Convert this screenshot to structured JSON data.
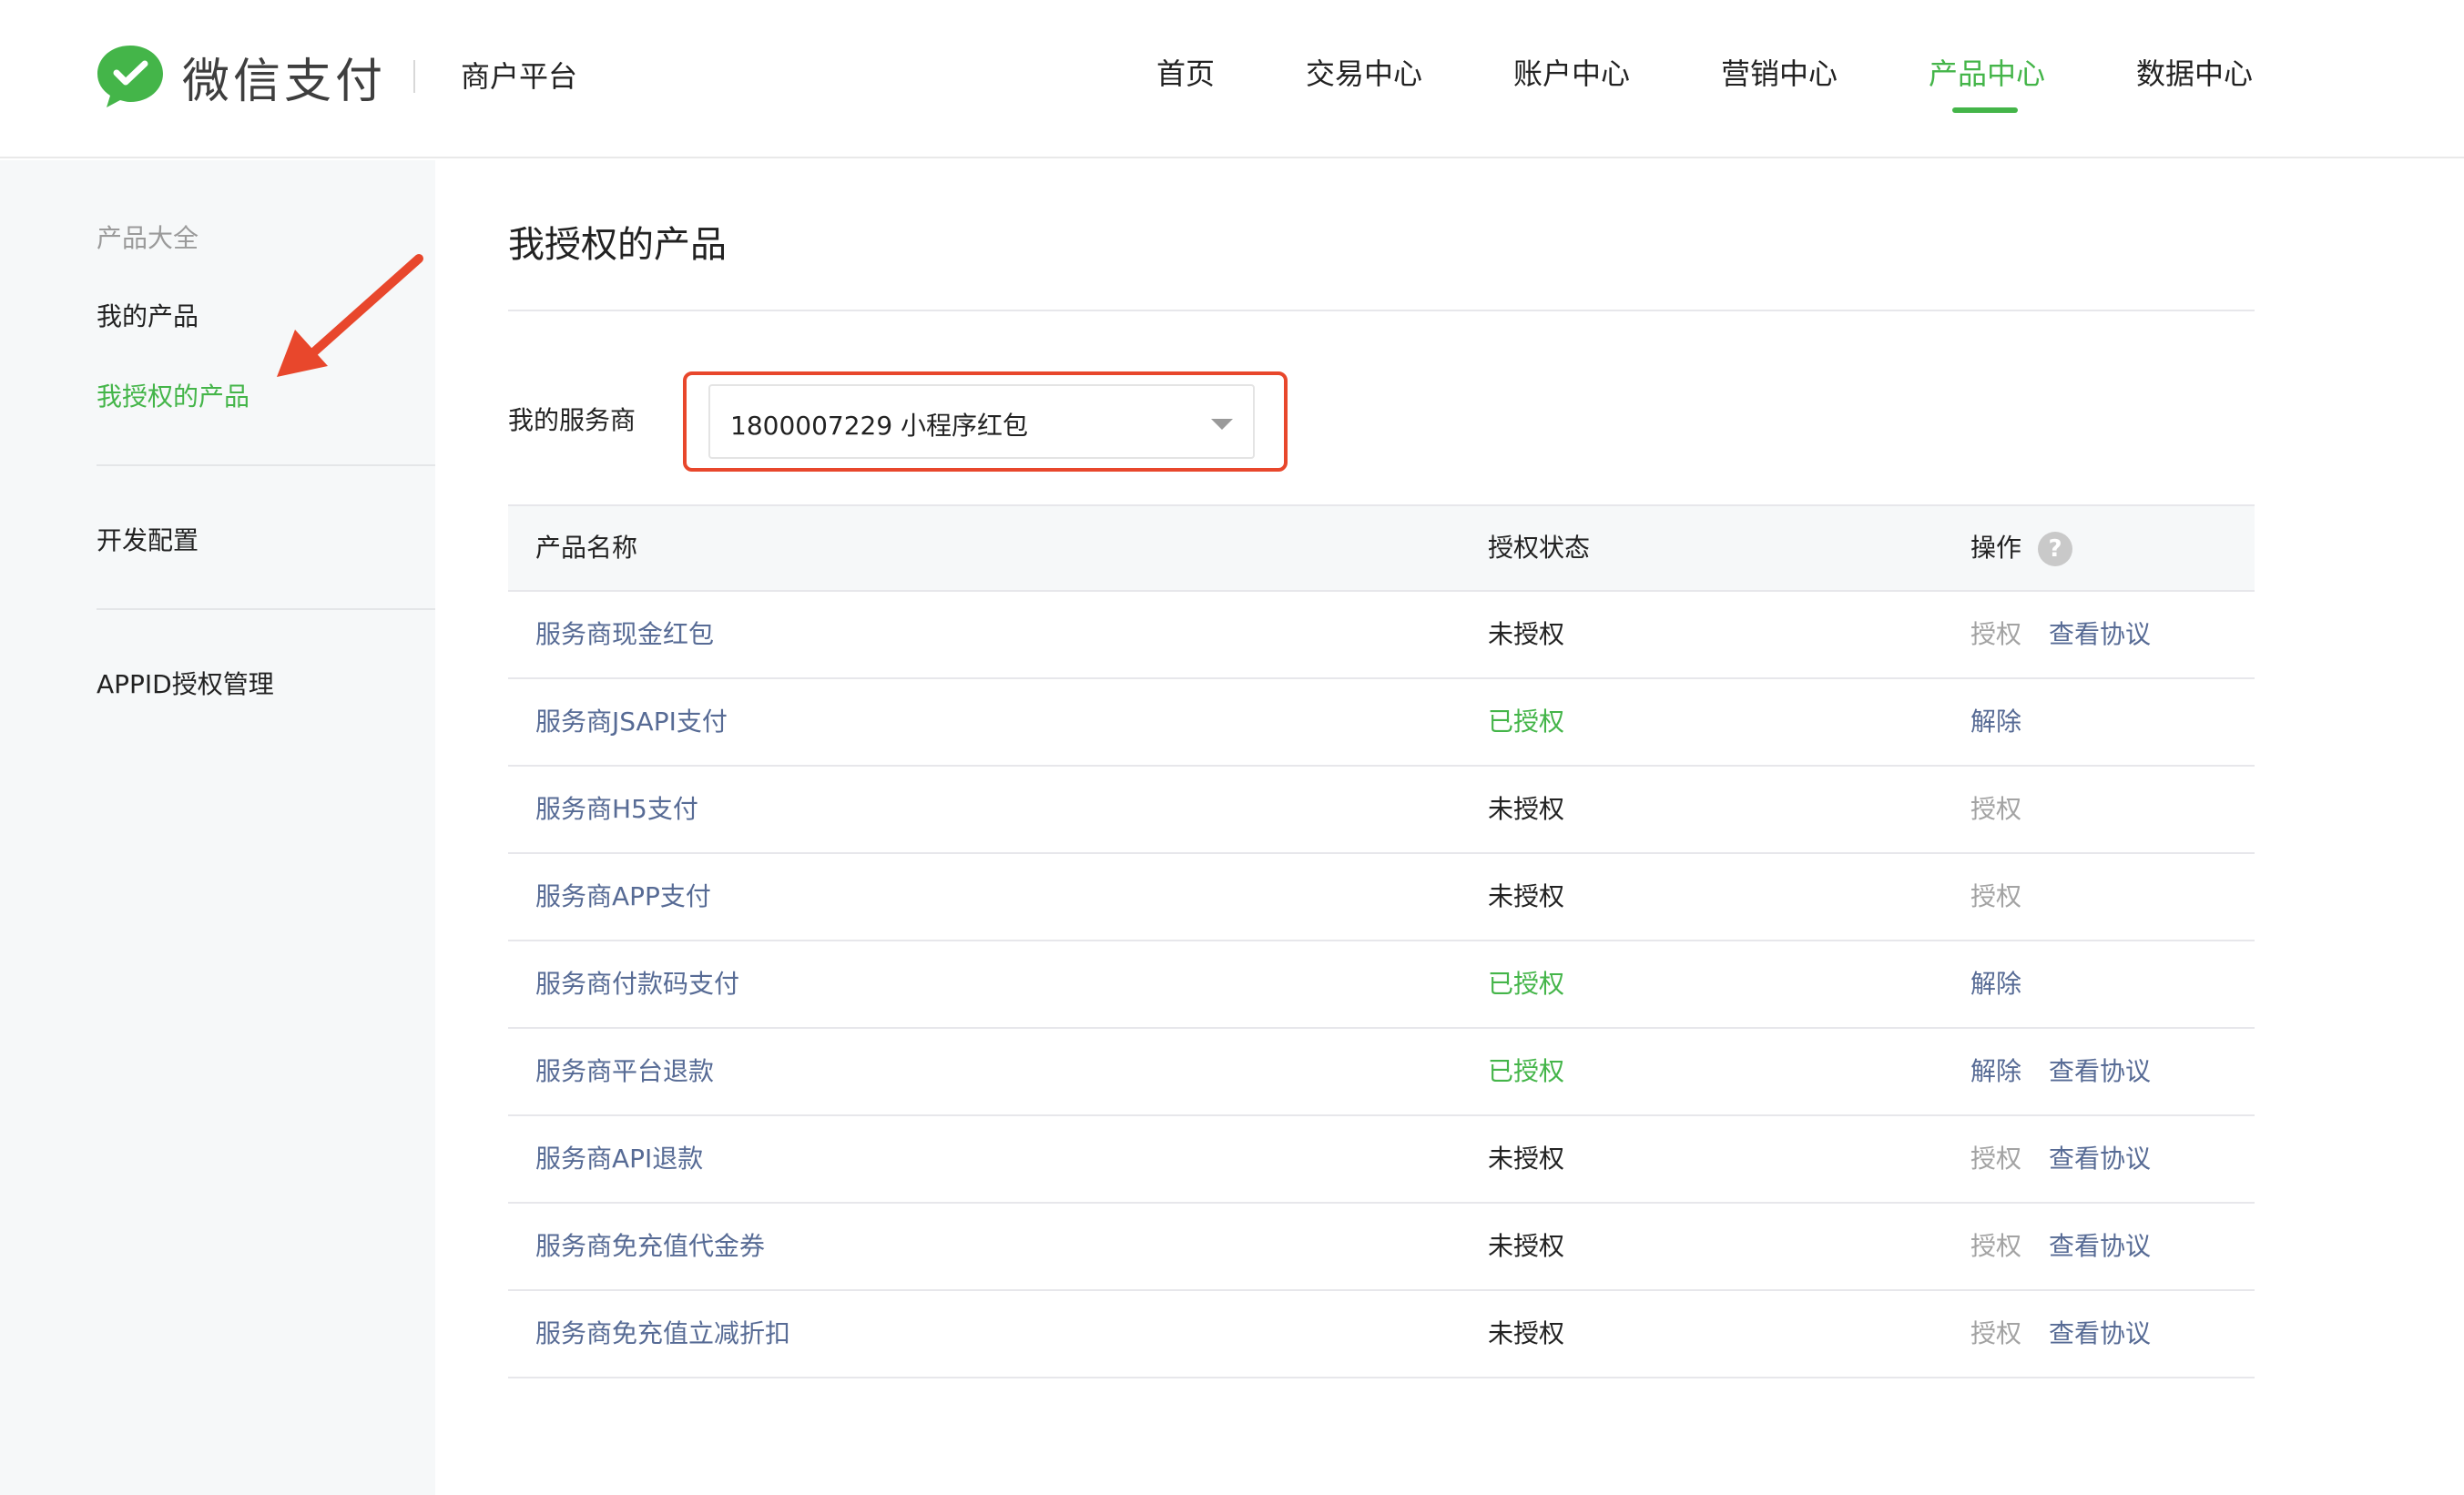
{
  "brand": {
    "name": "微信支付",
    "platform": "商户平台",
    "brand_color": "#44b549"
  },
  "nav": {
    "items": [
      "首页",
      "交易中心",
      "账户中心",
      "营销中心",
      "产品中心",
      "数据中心"
    ],
    "active": "产品中心"
  },
  "sidebar": {
    "group_title": "产品大全",
    "items": [
      "我的产品",
      "我授权的产品"
    ],
    "active": "我授权的产品",
    "dev_config": "开发配置",
    "appid": "APPID授权管理"
  },
  "main": {
    "title": "我授权的产品",
    "filter_label": "我的服务商",
    "selected_provider": "1800007229 小程序红包"
  },
  "table": {
    "headers": {
      "name": "产品名称",
      "status": "授权状态",
      "action": "操作",
      "help": "?"
    },
    "rows": [
      {
        "name": "服务商现金红包",
        "status": "未授权",
        "authorized": false,
        "action": "授权",
        "agreement": "查看协议"
      },
      {
        "name": "服务商JSAPI支付",
        "status": "已授权",
        "authorized": true,
        "action": "解除",
        "agreement": ""
      },
      {
        "name": "服务商H5支付",
        "status": "未授权",
        "authorized": false,
        "action": "授权",
        "agreement": ""
      },
      {
        "name": "服务商APP支付",
        "status": "未授权",
        "authorized": false,
        "action": "授权",
        "agreement": ""
      },
      {
        "name": "服务商付款码支付",
        "status": "已授权",
        "authorized": true,
        "action": "解除",
        "agreement": ""
      },
      {
        "name": "服务商平台退款",
        "status": "已授权",
        "authorized": true,
        "action": "解除",
        "agreement": "查看协议"
      },
      {
        "name": "服务商API退款",
        "status": "未授权",
        "authorized": false,
        "action": "授权",
        "agreement": "查看协议"
      },
      {
        "name": "服务商免充值代金券",
        "status": "未授权",
        "authorized": false,
        "action": "授权",
        "agreement": "查看协议"
      },
      {
        "name": "服务商免充值立减折扣",
        "status": "未授权",
        "authorized": false,
        "action": "授权",
        "agreement": "查看协议"
      }
    ]
  },
  "colors": {
    "link": "#576b95",
    "success": "#44b549",
    "disabled": "#a3a3a3",
    "annotation": "#e8472c"
  }
}
